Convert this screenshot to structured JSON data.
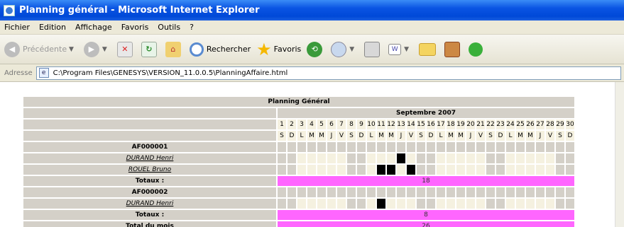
{
  "window": {
    "title": "Planning général - Microsoft Internet Explorer"
  },
  "menu": [
    "Fichier",
    "Edition",
    "Affichage",
    "Favoris",
    "Outils",
    "?"
  ],
  "toolbar": {
    "back": "Précédente",
    "search": "Rechercher",
    "favorites": "Favoris"
  },
  "address": {
    "label": "Adresse",
    "url": "C:\\Program Files\\GENESYS\\VERSION_11.0.0.5\\PlanningAffaire.html"
  },
  "planning": {
    "title": "Planning Général",
    "month": "Septembre 2007",
    "days": [
      "1",
      "2",
      "3",
      "4",
      "5",
      "6",
      "7",
      "8",
      "9",
      "10",
      "11",
      "12",
      "13",
      "14",
      "15",
      "16",
      "17",
      "18",
      "19",
      "20",
      "21",
      "22",
      "23",
      "24",
      "25",
      "26",
      "27",
      "28",
      "29",
      "30"
    ],
    "weekdays": [
      "S",
      "D",
      "L",
      "M",
      "M",
      "J",
      "V",
      "S",
      "D",
      "L",
      "M",
      "M",
      "J",
      "V",
      "S",
      "D",
      "L",
      "M",
      "M",
      "J",
      "V",
      "S",
      "D",
      "L",
      "M",
      "M",
      "J",
      "V",
      "S",
      "D"
    ],
    "totaux_label": "Totaux :",
    "total_mois_label": "Total du mois",
    "affaires": [
      {
        "code": "AF000001",
        "rows": [
          {
            "name": "DURAND Henri",
            "busy": [
              13
            ]
          },
          {
            "name": "ROUEL Bruno",
            "busy": [
              11,
              12,
              14
            ]
          }
        ],
        "total": "18"
      },
      {
        "code": "AF000002",
        "rows": [
          {
            "name": "DURAND Henri",
            "busy": [
              11
            ]
          }
        ],
        "total": "8"
      }
    ],
    "total_mois": "26"
  }
}
